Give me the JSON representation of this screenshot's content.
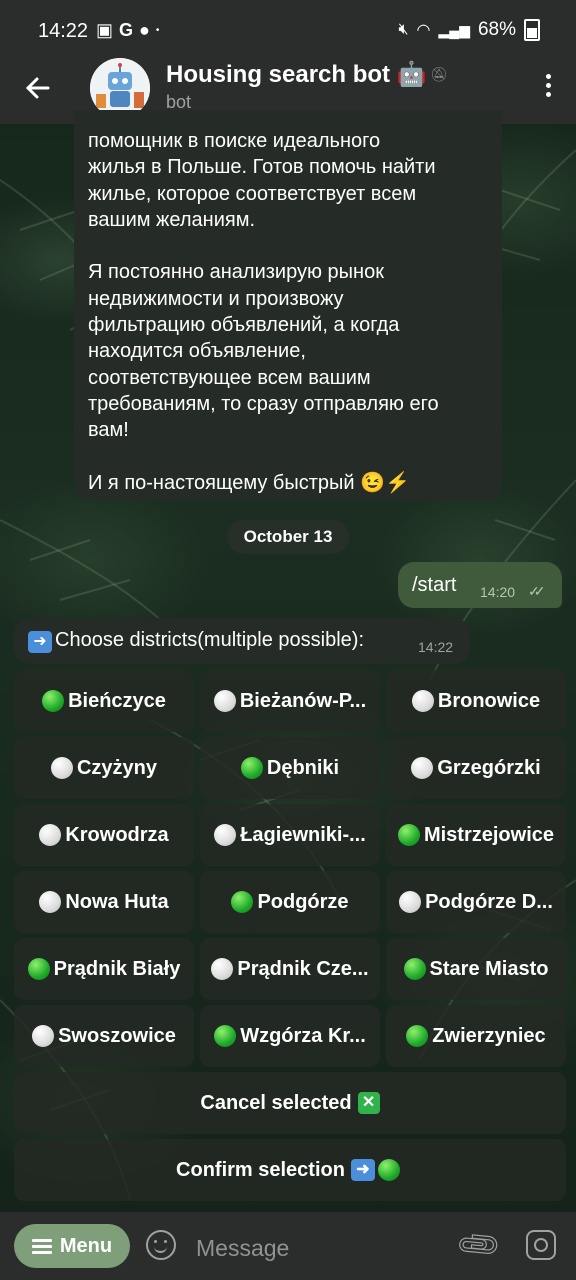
{
  "status_bar": {
    "time": "14:22",
    "battery": "68%"
  },
  "header": {
    "title": "Housing search bot",
    "subtitle": "bot"
  },
  "messages": {
    "bot_intro_text": "помощник в поиске идеального\nжилья в Польше. Готов помочь найти\nжилье, которое соответствует всем\nвашим желаниям.\n\nЯ постоянно анализирую рынок\nнедвижимости и произвожу\nфильтрацию объявлений, а когда\nнаходится объявление,\nсоответствующее всем вашим\nтребованиям, то сразу отправляю его\nвам!\n\nИ я по-настоящему быстрый 😉⚡",
    "date_chip": "October 13",
    "user_message": "/start",
    "user_time": "14:20",
    "keyboard_prompt": "Choose districts(multiple possible):",
    "keyboard_time": "14:22"
  },
  "districts": [
    {
      "label": "Bieńczyce",
      "selected": true
    },
    {
      "label": "Bieżanów-P...",
      "selected": false
    },
    {
      "label": "Bronowice",
      "selected": false
    },
    {
      "label": "Czyżyny",
      "selected": false
    },
    {
      "label": "Dębniki",
      "selected": true
    },
    {
      "label": "Grzegórzki",
      "selected": false
    },
    {
      "label": "Krowodrza",
      "selected": false
    },
    {
      "label": "Łagiewniki-...",
      "selected": false
    },
    {
      "label": "Mistrzejowice",
      "selected": true
    },
    {
      "label": "Nowa Huta",
      "selected": false
    },
    {
      "label": "Podgórze",
      "selected": true
    },
    {
      "label": "Podgórze D...",
      "selected": false
    },
    {
      "label": "Prądnik Biały",
      "selected": true
    },
    {
      "label": "Prądnik Cze...",
      "selected": false
    },
    {
      "label": "Stare Miasto",
      "selected": true
    },
    {
      "label": "Swoszowice",
      "selected": false
    },
    {
      "label": "Wzgórza Kr...",
      "selected": true
    },
    {
      "label": "Zwierzyniec",
      "selected": true
    }
  ],
  "actions": {
    "cancel_label": "Cancel selected",
    "confirm_label": "Confirm selection"
  },
  "input": {
    "menu_label": "Menu",
    "placeholder": "Message"
  },
  "colors": {
    "bar_background": "#2a2d2b",
    "incoming_bubble": "#252b26",
    "outgoing_bubble": "#405b3b",
    "menu_button": "#7f9e7a",
    "selected_dot": "#1faa2a",
    "unselected_dot": "#dcdcdc"
  }
}
